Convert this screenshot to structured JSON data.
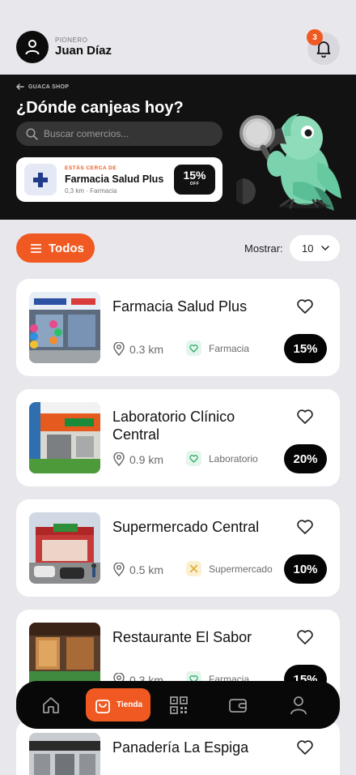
{
  "user": {
    "rank": "PIONERO",
    "name": "Juan Díaz"
  },
  "notifications": {
    "count": "3"
  },
  "hero": {
    "breadcrumb": "GUACA SHOP",
    "title": "¿Dónde canjeas hoy?",
    "search_placeholder": "Buscar comercios...",
    "nearby": {
      "kicker": "ESTÁS CERCA DE",
      "name": "Farmacia Salud Plus",
      "meta": "0,3 km · Farmacia",
      "discount": "15%",
      "off_label": "OFF"
    }
  },
  "filters": {
    "category_label": "Todos",
    "show_label": "Mostrar:",
    "show_value": "10"
  },
  "stores": [
    {
      "name": "Farmacia Salud Plus",
      "distance": "0.3 km",
      "category": "Farmacia",
      "category_icon": "heart-icon",
      "category_color": "#2fa86a",
      "discount": "15%",
      "thumb": "pharmacy-photo"
    },
    {
      "name": "Laboratorio Clínico Central",
      "distance": "0.9 km",
      "category": "Laboratorio",
      "category_icon": "heart-icon",
      "category_color": "#2fa86a",
      "discount": "20%",
      "thumb": "laboratory-photo"
    },
    {
      "name": "Supermercado Central",
      "distance": "0.5 km",
      "category": "Supermercado",
      "category_icon": "utensils-icon",
      "category_color": "#d9a21b",
      "discount": "10%",
      "thumb": "supermarket-photo"
    },
    {
      "name": "Restaurante El Sabor",
      "distance": "0.3 km",
      "category": "Farmacia",
      "category_icon": "heart-icon",
      "category_color": "#2fa86a",
      "discount": "15%",
      "thumb": "restaurant-photo"
    },
    {
      "name": "Panadería La Espiga",
      "thumb": "bakery-photo"
    }
  ],
  "nav": {
    "items": [
      {
        "icon": "home-icon"
      },
      {
        "icon": "shopping-bag-icon",
        "label": "Tienda",
        "active": true
      },
      {
        "icon": "qr-code-icon"
      },
      {
        "icon": "wallet-icon"
      },
      {
        "icon": "user-icon"
      }
    ]
  },
  "colors": {
    "accent": "#f05a22",
    "dark": "#121212",
    "background": "#e8e7ec"
  }
}
